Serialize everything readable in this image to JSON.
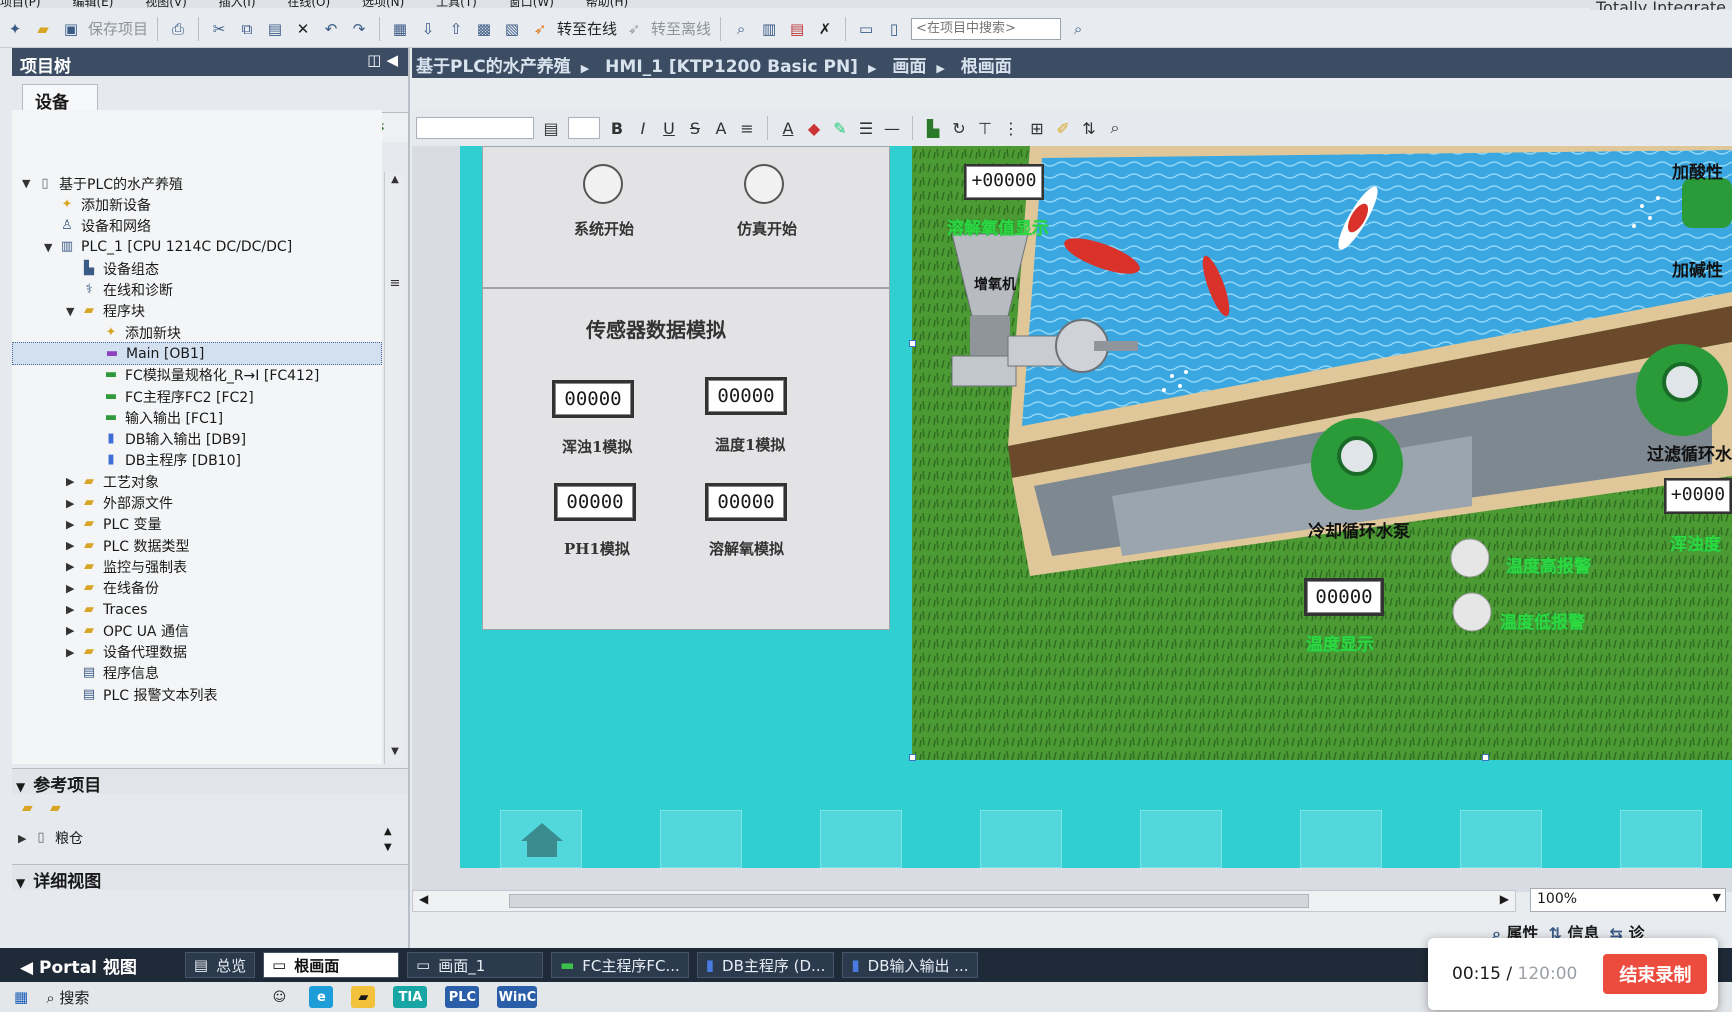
{
  "menu": {
    "items": [
      "项目(P)",
      "编辑(E)",
      "视图(V)",
      "插入(I)",
      "在线(O)",
      "选项(N)",
      "工具(T)",
      "窗口(W)",
      "帮助(H)"
    ],
    "brand": "Totally Integrate"
  },
  "toolbar": {
    "save_project": "保存项目",
    "go_online": "转至在线",
    "go_offline": "转至离线",
    "search_placeholder": "<在项目中搜索>"
  },
  "project_tree": {
    "title": "项目树",
    "devices_tab": "设备",
    "items": [
      {
        "label": "基于PLC的水产养殖",
        "level": 0,
        "expanded": true,
        "icon": "project-icon"
      },
      {
        "label": "添加新设备",
        "level": 1,
        "icon": "add-device-icon"
      },
      {
        "label": "设备和网络",
        "level": 1,
        "icon": "network-icon"
      },
      {
        "label": "PLC_1 [CPU 1214C DC/DC/DC]",
        "level": 1,
        "expanded": true,
        "icon": "plc-icon"
      },
      {
        "label": "设备组态",
        "level": 2,
        "icon": "device-config-icon"
      },
      {
        "label": "在线和诊断",
        "level": 2,
        "icon": "diagnostics-icon"
      },
      {
        "label": "程序块",
        "level": 2,
        "expanded": true,
        "icon": "folder-icon"
      },
      {
        "label": "添加新块",
        "level": 3,
        "icon": "add-block-icon"
      },
      {
        "label": "Main [OB1]",
        "level": 3,
        "selected": true,
        "icon": "ob-block-icon"
      },
      {
        "label": "FC模拟量规格化_R→I [FC412]",
        "level": 3,
        "icon": "fc-block-icon"
      },
      {
        "label": "FC主程序FC2 [FC2]",
        "level": 3,
        "icon": "fc-block-icon"
      },
      {
        "label": "输入输出 [FC1]",
        "level": 3,
        "icon": "fc-block-icon"
      },
      {
        "label": "DB输入输出 [DB9]",
        "level": 3,
        "icon": "db-block-icon"
      },
      {
        "label": "DB主程序 [DB10]",
        "level": 3,
        "icon": "db-block-icon"
      },
      {
        "label": "工艺对象",
        "level": 2,
        "expanded": false,
        "icon": "folder-icon"
      },
      {
        "label": "外部源文件",
        "level": 2,
        "expanded": false,
        "icon": "folder-icon"
      },
      {
        "label": "PLC 变量",
        "level": 2,
        "expanded": false,
        "icon": "folder-icon"
      },
      {
        "label": "PLC 数据类型",
        "level": 2,
        "expanded": false,
        "icon": "folder-icon"
      },
      {
        "label": "监控与强制表",
        "level": 2,
        "expanded": false,
        "icon": "folder-icon"
      },
      {
        "label": "在线备份",
        "level": 2,
        "expanded": false,
        "icon": "folder-icon"
      },
      {
        "label": "Traces",
        "level": 2,
        "expanded": false,
        "icon": "folder-icon"
      },
      {
        "label": "OPC UA 通信",
        "level": 2,
        "expanded": false,
        "icon": "folder-icon"
      },
      {
        "label": "设备代理数据",
        "level": 2,
        "expanded": false,
        "icon": "folder-icon"
      },
      {
        "label": "程序信息",
        "level": 2,
        "icon": "program-info-icon"
      },
      {
        "label": "PLC 报警文本列表",
        "level": 2,
        "icon": "alarm-text-icon"
      }
    ],
    "reference_title": "参考项目",
    "reference_item": "粮仓",
    "detail_title": "详细视图"
  },
  "breadcrumb": [
    "基于PLC的水产养殖",
    "HMI_1 [KTP1200 Basic PN]",
    "画面",
    "根画面"
  ],
  "format_toolbar": [
    "B",
    "I",
    "U",
    "S",
    "A"
  ],
  "hmi": {
    "btn_system_start": "系统开始",
    "btn_sim_start": "仿真开始",
    "sensor_title": "传感器数据模拟",
    "sensors": [
      {
        "value": "00000",
        "label": "浑浊1模拟"
      },
      {
        "value": "00000",
        "label": "温度1模拟"
      },
      {
        "value": "00000",
        "label": "PH1模拟"
      },
      {
        "value": "00000",
        "label": "溶解氧模拟"
      }
    ],
    "oxygen_display_value": "+00000",
    "oxygen_display_label": "溶解氧值显示",
    "aerator": "增氧机",
    "add_acid": "加酸性",
    "add_alkali": "加碱性",
    "cooling_pump": "冷却循环水泵",
    "filter_pump": "过滤循环水",
    "right_value": "+0000",
    "right_green_label": "浑浊度",
    "temp_high_alarm": "温度高报警",
    "temp_low_alarm": "温度低报警",
    "temp_display_value": "00000",
    "temp_display_label": "温度显示"
  },
  "zoom": "100%",
  "inspector_tabs": [
    "属性",
    "信息",
    "诊"
  ],
  "portal": {
    "view_button": "Portal 视图",
    "tabs": [
      "总览",
      "根画面",
      "画面_1",
      "FC主程序FC...",
      "DB主程序 (D...",
      "DB输入输出 ..."
    ]
  },
  "taskbar": {
    "search": "搜索",
    "apps": [
      "TIA",
      "PLC",
      "WinC"
    ]
  },
  "recording": {
    "elapsed": "00:15",
    "total": "120:00",
    "stop": "结束录制"
  }
}
